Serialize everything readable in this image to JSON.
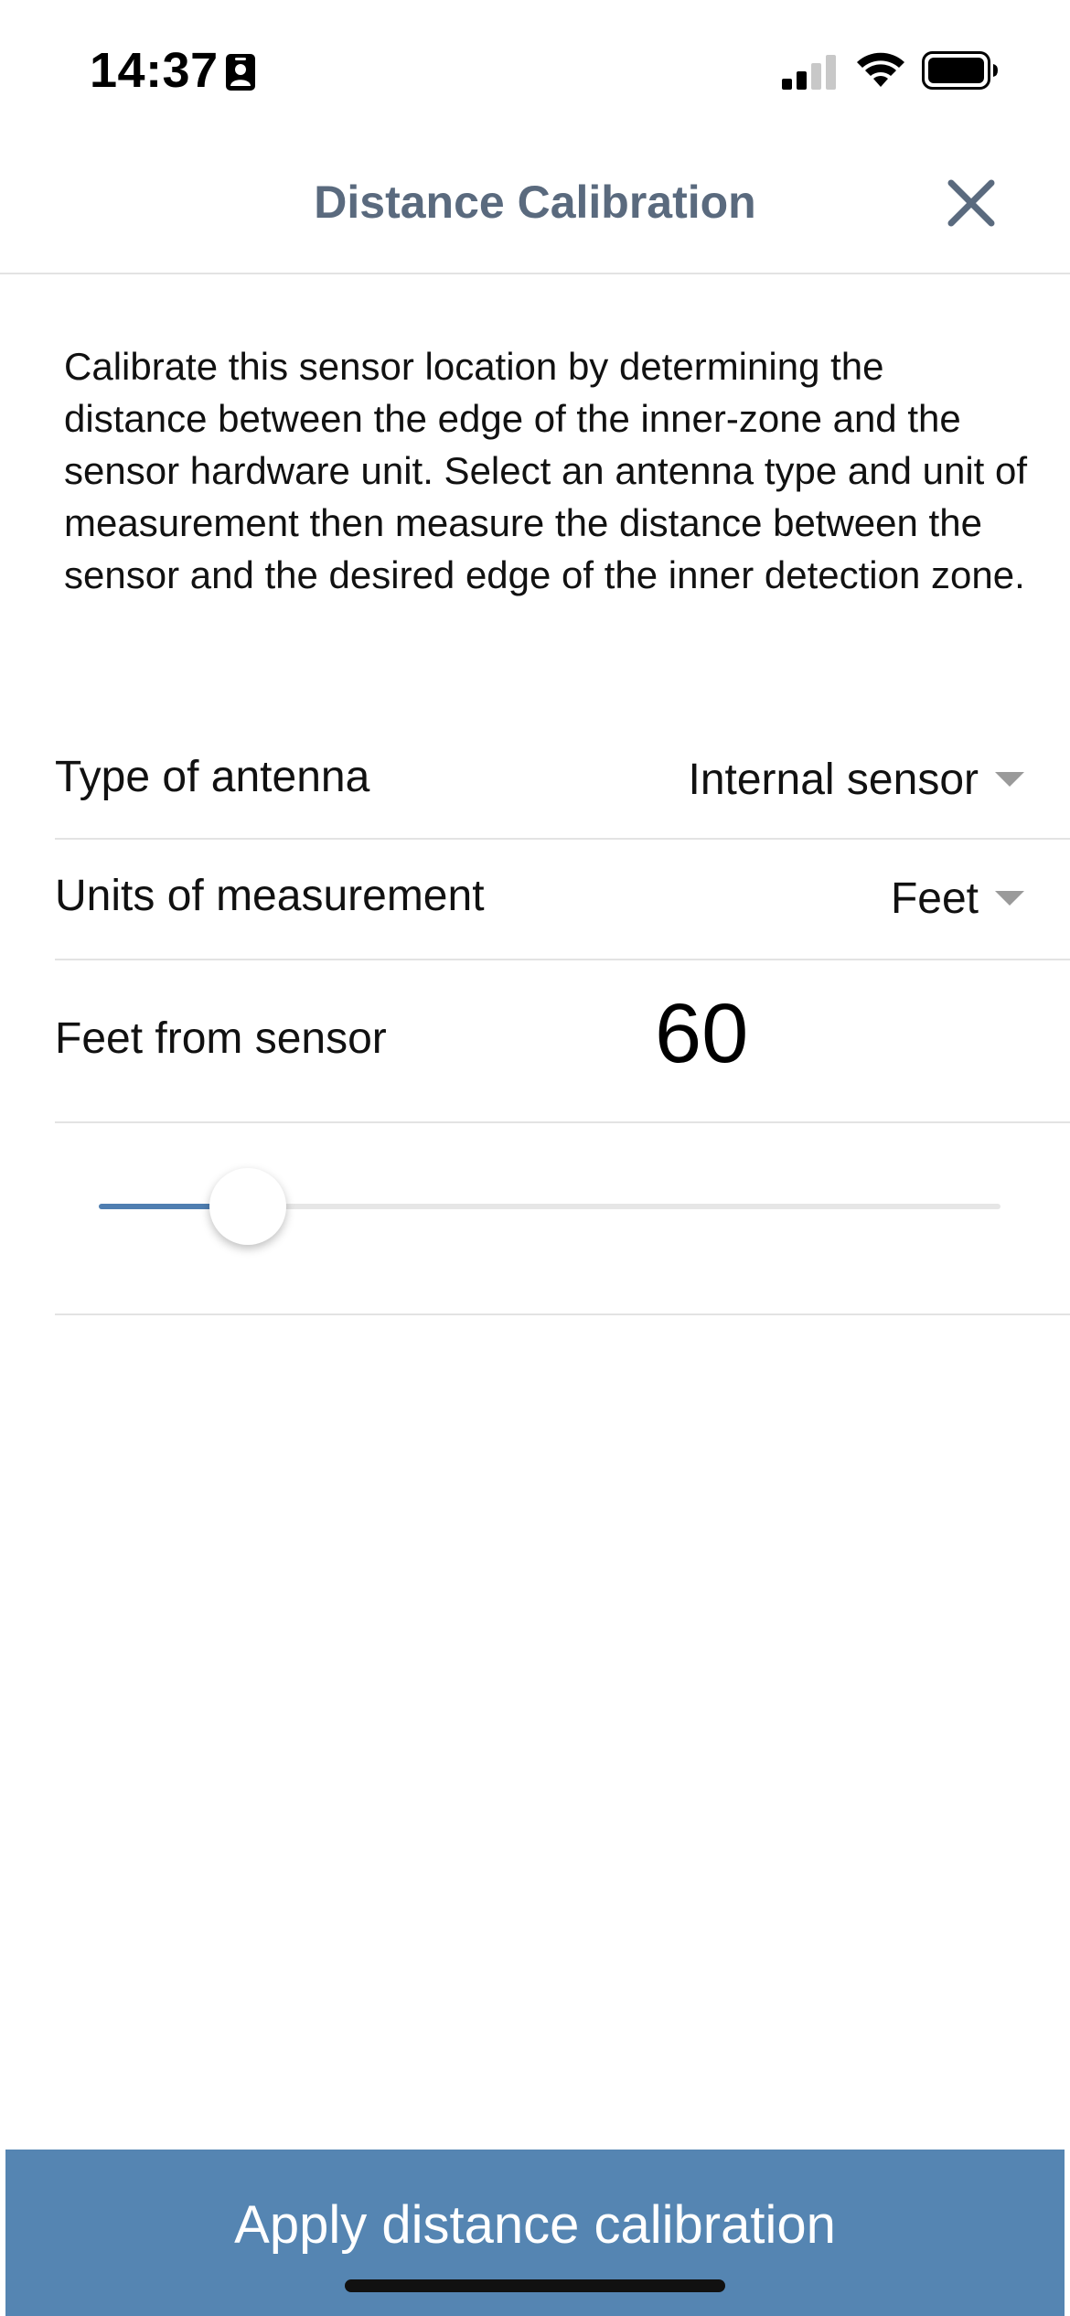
{
  "status_bar": {
    "time": "14:37",
    "id_icon": "person-card-icon",
    "signal_icon": "cellular-signal-icon",
    "wifi_icon": "wifi-icon",
    "battery_icon": "battery-icon"
  },
  "header": {
    "title": "Distance Calibration",
    "close_icon": "close-icon"
  },
  "description": "Calibrate this sensor location by determining the distance between the edge of the inner-zone and the sensor hardware unit. Select an antenna type and unit of measurement then measure the distance between the sensor and the desired edge of the inner detection zone.",
  "antenna": {
    "label": "Type of antenna",
    "value": "Internal sensor"
  },
  "units": {
    "label": "Units of measurement",
    "value": "Feet"
  },
  "distance": {
    "label": "Feet from sensor",
    "value": "60"
  },
  "slider": {
    "fraction": 0.165
  },
  "apply_button": {
    "label": "Apply distance calibration"
  },
  "colors": {
    "accent": "#5585b2",
    "title": "#5a6a7e",
    "slider_fill": "#4f7eb1",
    "caret": "#9a9a9a",
    "divider": "#e3e3e3"
  }
}
